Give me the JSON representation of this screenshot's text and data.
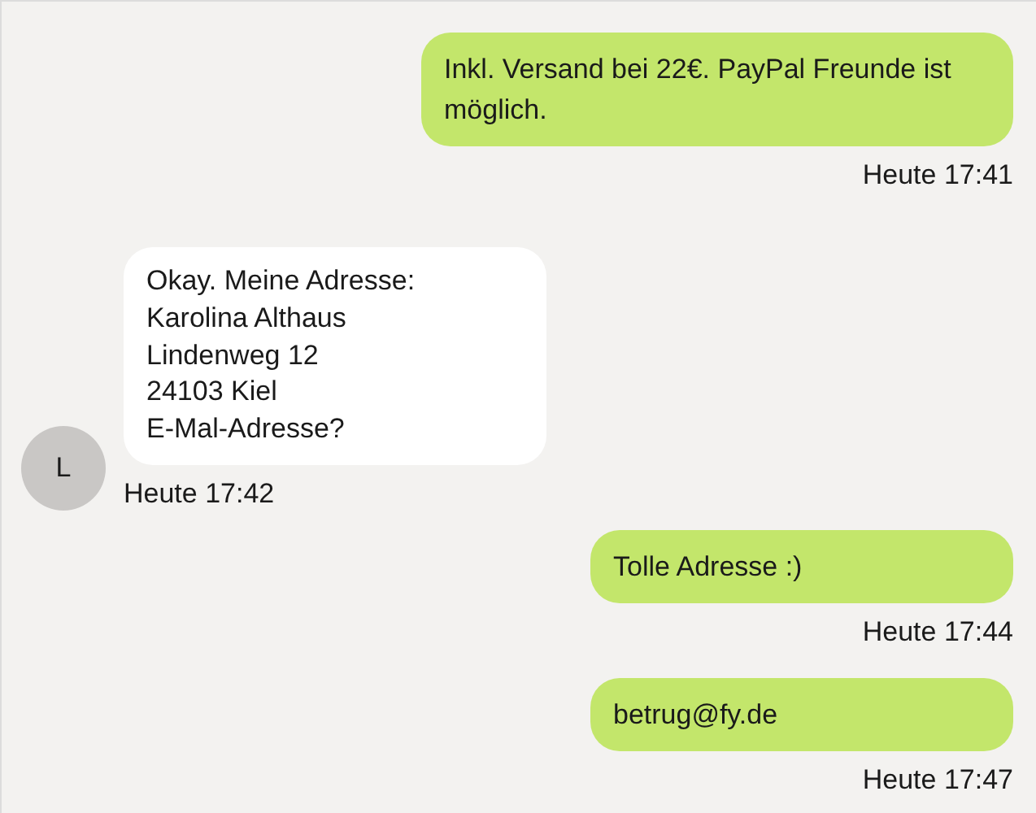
{
  "messages": [
    {
      "kind": "outgoing",
      "text": "Inkl. Versand bei 22€. PayPal Freunde ist möglich.",
      "time": "Heute 17:41"
    },
    {
      "kind": "incoming",
      "text": "Okay. Meine Adresse:\nKarolina Althaus\nLindenweg 12\n24103 Kiel\nE-Mal-Adresse?",
      "time": "Heute 17:42",
      "avatar": "L"
    },
    {
      "kind": "outgoing",
      "text": "Tolle Adresse :)",
      "time": "Heute 17:44"
    },
    {
      "kind": "outgoing",
      "text": "betrug@fy.de",
      "time": "Heute 17:47"
    }
  ]
}
